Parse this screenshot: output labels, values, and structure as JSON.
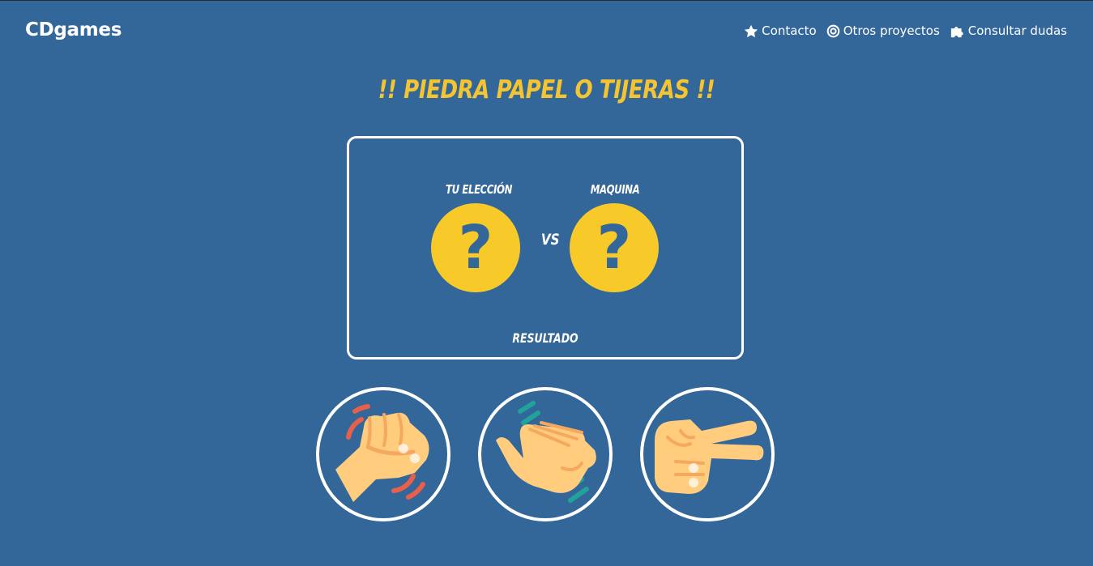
{
  "header": {
    "brand": "CDgames",
    "nav": [
      {
        "label": "Contacto",
        "icon": "star-icon"
      },
      {
        "label": "Otros proyectos",
        "icon": "target-icon"
      },
      {
        "label": "Consultar dudas",
        "icon": "puzzle-icon"
      }
    ]
  },
  "game": {
    "title": "!! PIEDRA PAPEL O TIJERAS !!",
    "player_label": "TU ELECCIÓN",
    "machine_label": "MAQUINA",
    "player_pick": "?",
    "machine_pick": "?",
    "vs_label": "VS",
    "result_label": "RESULTADO"
  },
  "choices": [
    {
      "name": "piedra",
      "icon": "rock-fist-icon"
    },
    {
      "name": "papel",
      "icon": "paper-hand-icon"
    },
    {
      "name": "tijeras",
      "icon": "scissors-hand-icon"
    }
  ],
  "colors": {
    "background": "#336699",
    "accent_yellow": "#F5C531",
    "coin_yellow": "#F7CA2A",
    "skin": "#FFCD7D",
    "skin_shadow": "#F5A860",
    "motion_red": "#E8604A",
    "motion_teal": "#1FA39A"
  }
}
